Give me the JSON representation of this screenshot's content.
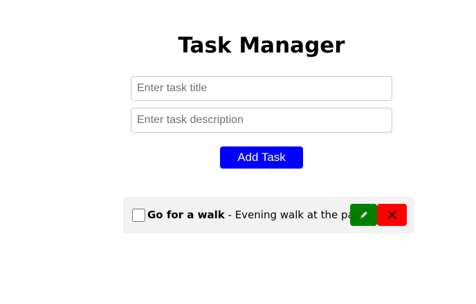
{
  "header": {
    "title": "Task Manager"
  },
  "form": {
    "title_placeholder": "Enter task title",
    "title_value": "",
    "description_placeholder": "Enter task description",
    "description_value": "",
    "add_button_label": "Add Task"
  },
  "tasks": [
    {
      "title": "Go for a walk",
      "separator": " - ",
      "description": "Evening walk at the park",
      "completed": false,
      "edit_icon": "pencil-icon",
      "delete_icon": "close-icon"
    }
  ],
  "colors": {
    "add_button": "#0000ff",
    "edit_button": "#008000",
    "delete_button": "#ff0000",
    "task_background": "#f2f2f2"
  }
}
